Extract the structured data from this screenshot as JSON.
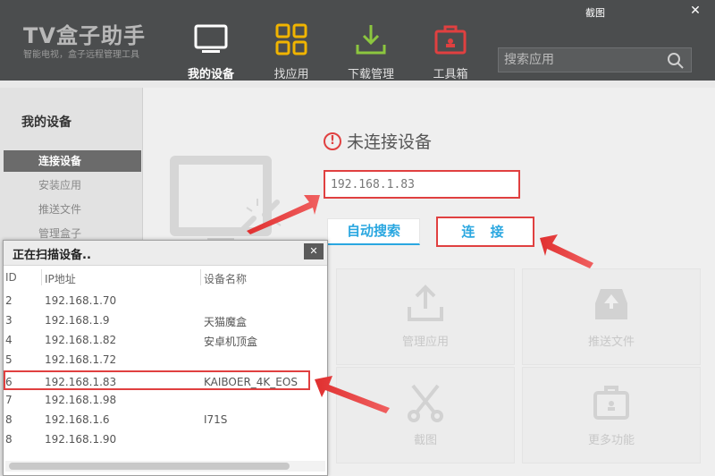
{
  "window": {
    "title": "截图",
    "close_label": "✕"
  },
  "header": {
    "app_name": "TV盒子助手",
    "app_subtitle": "智能电视，盒子远程管理工具",
    "nav": [
      {
        "label": "我的设备",
        "icon": "tv-icon",
        "active": true
      },
      {
        "label": "找应用",
        "icon": "grid-icon",
        "active": false
      },
      {
        "label": "下载管理",
        "icon": "download-icon",
        "active": false
      },
      {
        "label": "工具箱",
        "icon": "toolbox-icon",
        "active": false
      }
    ],
    "search": {
      "placeholder": "搜索应用",
      "icon": "search-icon"
    }
  },
  "sidebar": {
    "title": "我的设备",
    "items": [
      {
        "label": "连接设备",
        "active": true
      },
      {
        "label": "安装应用",
        "active": false
      },
      {
        "label": "推送文件",
        "active": false
      },
      {
        "label": "管理盒子",
        "active": false
      }
    ]
  },
  "main": {
    "status_text": "未连接设备",
    "status_icon": "warning-icon",
    "ip_value": "192.168.1.83",
    "auto_search_label": "自动搜索",
    "connect_label": "连 接",
    "tiles": [
      {
        "label": "管理应用",
        "icon": "upload-icon"
      },
      {
        "label": "推送文件",
        "icon": "inbox-icon"
      },
      {
        "label": "截图",
        "icon": "scissors-icon"
      },
      {
        "label": "更多功能",
        "icon": "briefcase-icon"
      }
    ]
  },
  "scan_popup": {
    "title": "正在扫描设备..",
    "close_label": "✕",
    "columns": [
      "ID",
      "IP地址",
      "设备名称"
    ],
    "rows": [
      {
        "id": "2",
        "ip": "192.168.1.70",
        "name": ""
      },
      {
        "id": "3",
        "ip": "192.168.1.9",
        "name": "天猫魔盒"
      },
      {
        "id": "4",
        "ip": "192.168.1.82",
        "name": "安卓机顶盒"
      },
      {
        "id": "5",
        "ip": "192.168.1.72",
        "name": ""
      },
      {
        "id": "6",
        "ip": "192.168.1.83",
        "name": "KAIBOER_4K_EOS"
      },
      {
        "id": "7",
        "ip": "192.168.1.98",
        "name": ""
      },
      {
        "id": "8",
        "ip": "192.168.1.6",
        "name": "I71S"
      },
      {
        "id": "8",
        "ip": "192.168.1.90",
        "name": ""
      }
    ]
  },
  "colors": {
    "header_bg": "#4b4d4e",
    "accent_blue": "#2aa7e0",
    "highlight_red": "#e04040"
  }
}
